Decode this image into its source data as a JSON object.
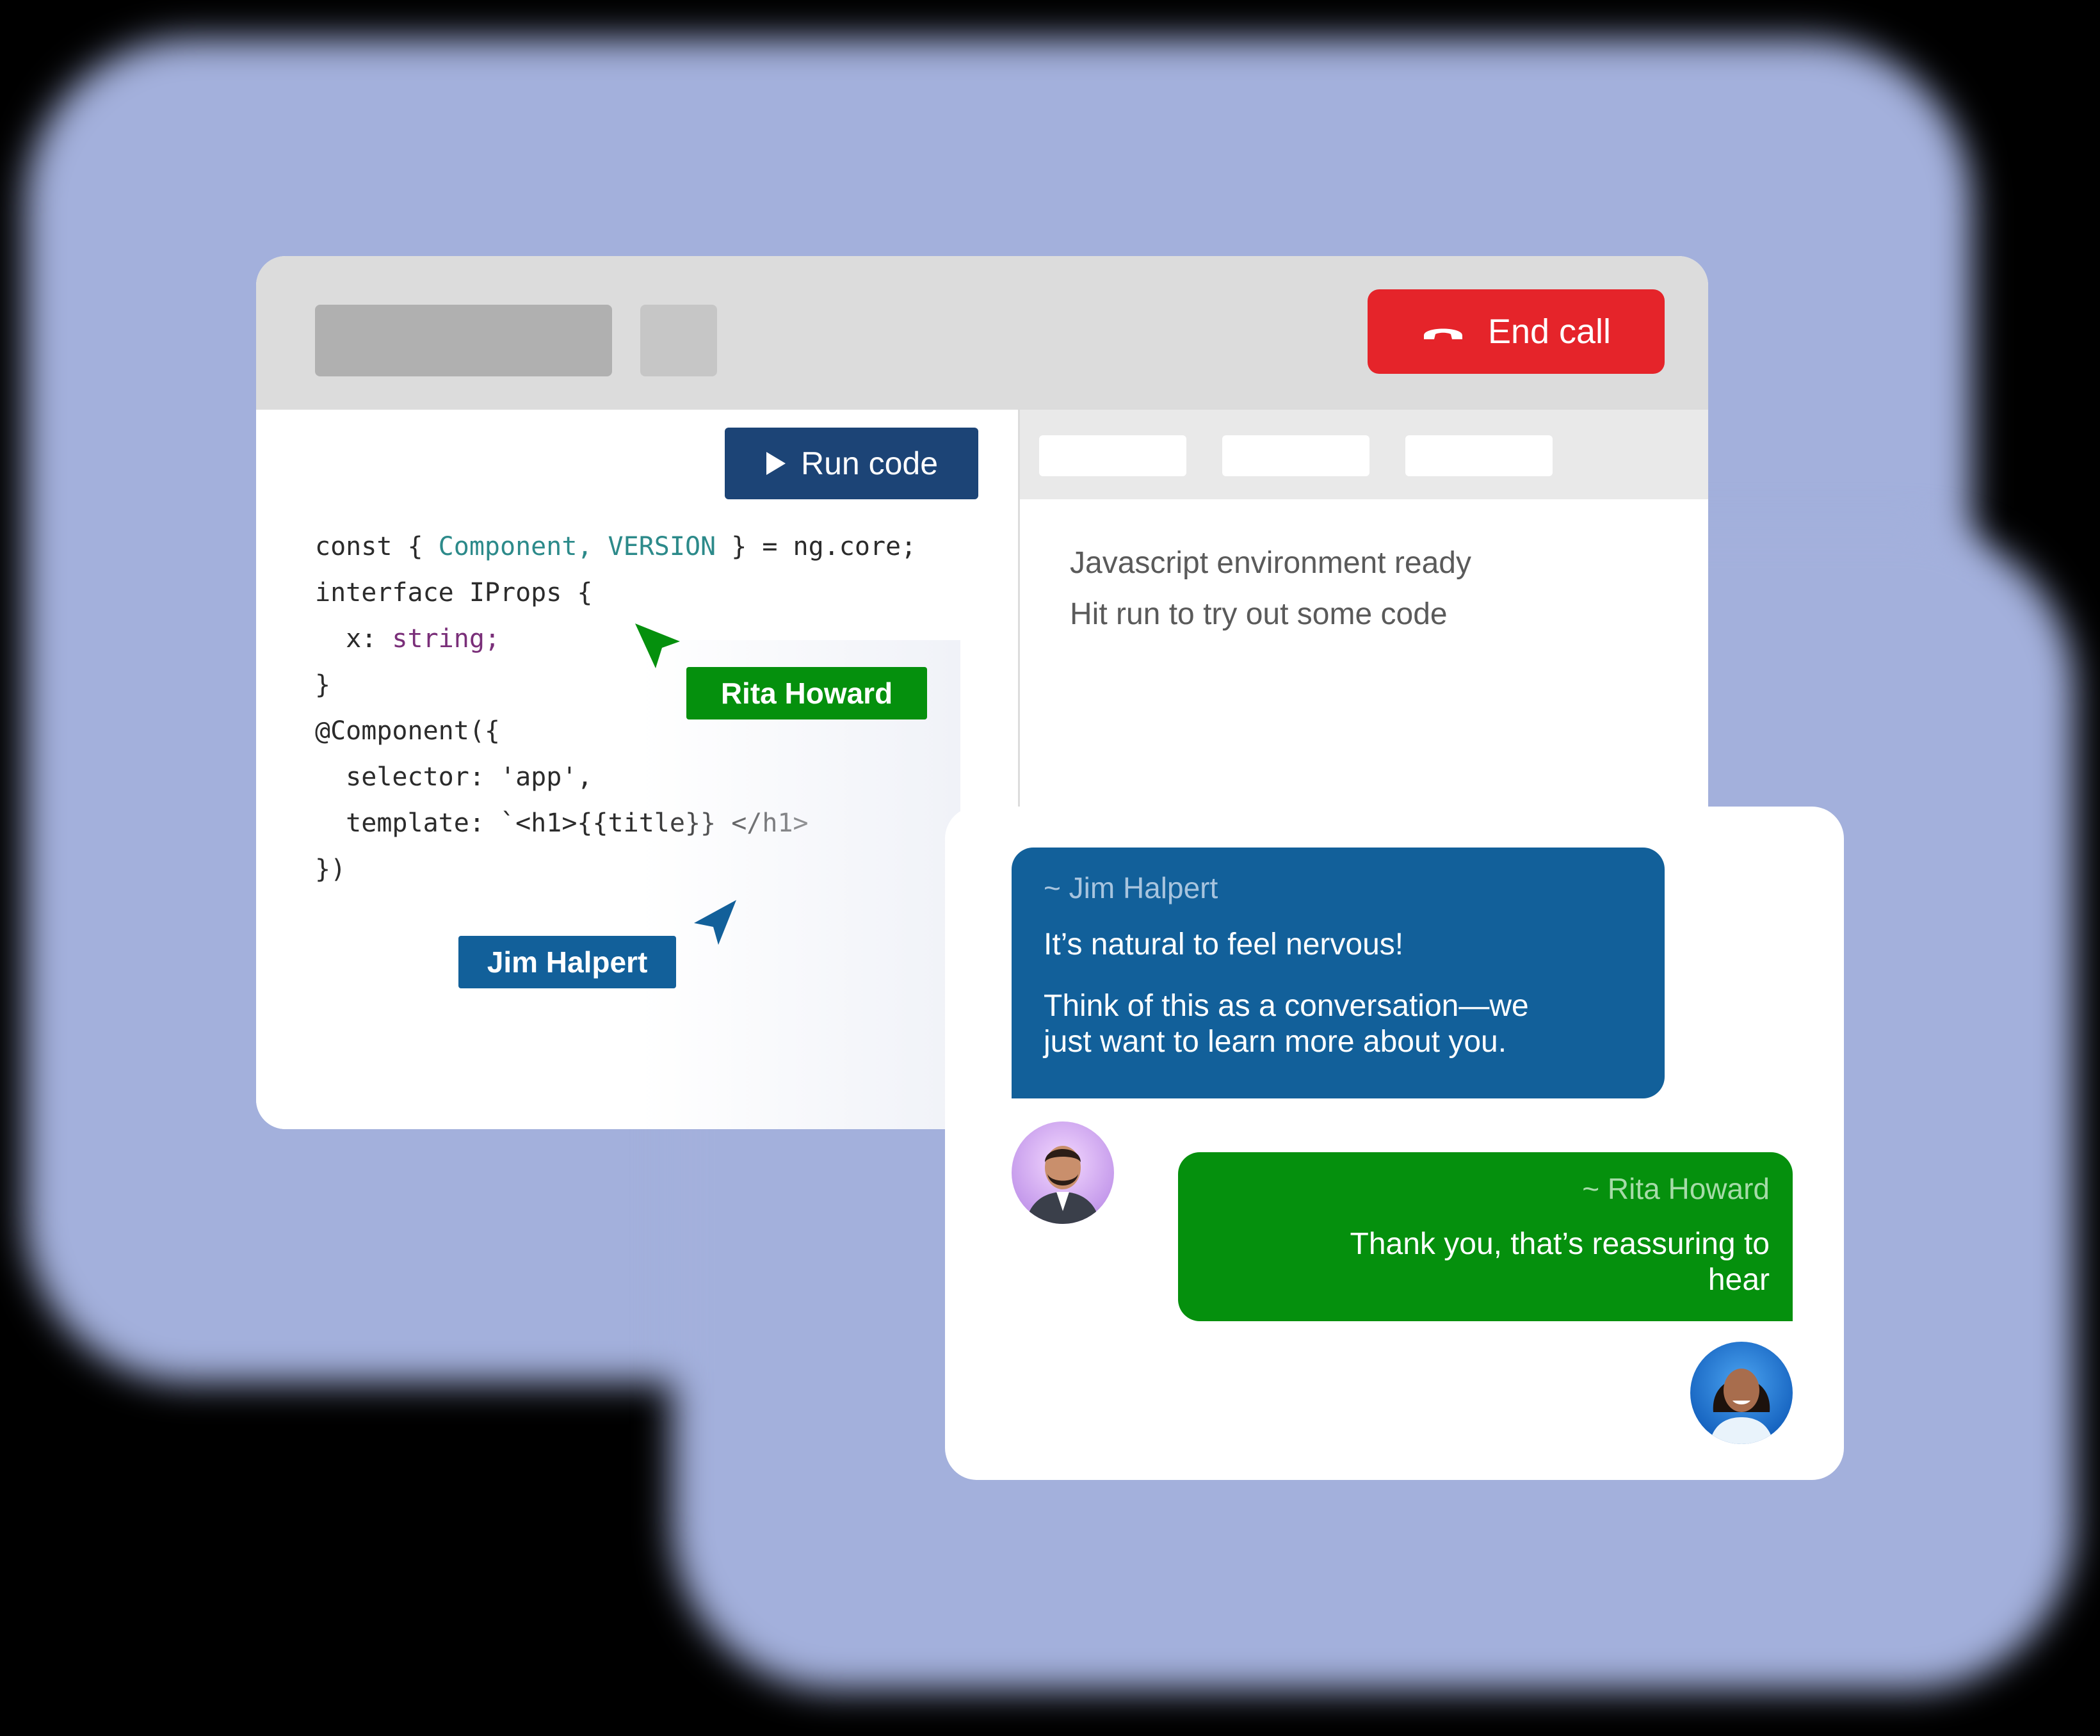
{
  "window": {
    "end_call_label": "End call"
  },
  "editor": {
    "run_label": "Run code",
    "code_lines": [
      {
        "segments": [
          {
            "text": "const { ",
            "tone": "plain"
          },
          {
            "text": "Component, VERSION",
            "tone": "teal"
          },
          {
            "text": " } = ng.core;",
            "tone": "plain"
          }
        ]
      },
      {
        "segments": [
          {
            "text": "interface IProps {",
            "tone": "plain"
          }
        ]
      },
      {
        "segments": [
          {
            "text": "  x: ",
            "tone": "plain"
          },
          {
            "text": "string;",
            "tone": "purple"
          }
        ]
      },
      {
        "segments": [
          {
            "text": "}",
            "tone": "plain"
          }
        ]
      },
      {
        "segments": [
          {
            "text": "@Component({",
            "tone": "plain"
          }
        ]
      },
      {
        "segments": [
          {
            "text": "  selector: 'app',",
            "tone": "plain"
          }
        ]
      },
      {
        "segments": [
          {
            "text": "  template: `<h1>{{title}} </h1>",
            "tone": "plain"
          }
        ]
      },
      {
        "segments": [
          {
            "text": "})",
            "tone": "plain"
          }
        ]
      }
    ]
  },
  "output": {
    "line1": "Javascript environment ready",
    "line2": "Hit run to  try out some code"
  },
  "cursors": {
    "rita": {
      "name": "Rita Howard",
      "color": "#05900d"
    },
    "jim": {
      "name": "Jim Halpert",
      "color": "#12609a"
    }
  },
  "chat": {
    "jim": {
      "author": "~ Jim Halpert",
      "line1": "It’s natural to feel nervous!",
      "line2": "Think of this as a conversation—we",
      "line3": "just want to learn more about you."
    },
    "rita": {
      "author": "~ Rita Howard",
      "line1": "Thank you, that’s reassuring to",
      "line2": "hear"
    }
  },
  "colors": {
    "end_call": "#e5242a",
    "run_button": "#1c4476",
    "jim_blue": "#12609a",
    "rita_green": "#05900d",
    "glow": "#a3b0dc"
  }
}
